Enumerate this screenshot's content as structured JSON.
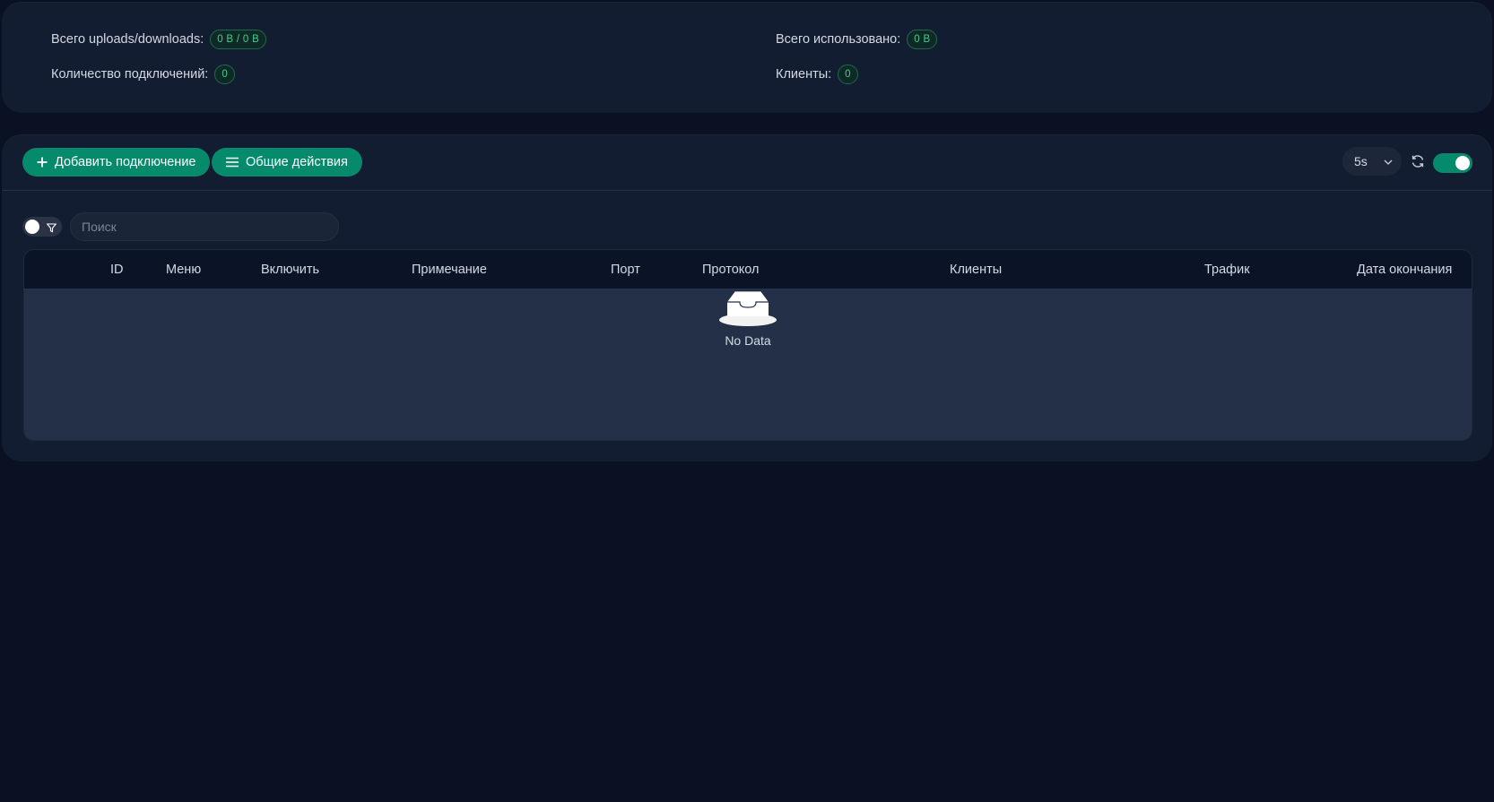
{
  "stats": {
    "total_updown_label": "Всего uploads/downloads:",
    "total_updown_value": "0 B / 0 B",
    "total_used_label": "Всего использовано:",
    "total_used_value": "0 B",
    "connections_label": "Количество подключений:",
    "connections_value": "0",
    "clients_label": "Клиенты:",
    "clients_value": "0"
  },
  "toolbar": {
    "add_label": "Добавить подключение",
    "actions_label": "Общие действия",
    "refresh_interval": "5s",
    "auto_refresh_on": true
  },
  "filter": {
    "search_placeholder": "Поиск",
    "filter_enabled": false
  },
  "table": {
    "columns": [
      "ID",
      "Меню",
      "Включить",
      "Примечание",
      "Порт",
      "Протокол",
      "Клиенты",
      "Трафик",
      "Дата окончания"
    ],
    "rows": [],
    "empty_text": "No Data"
  },
  "colors": {
    "accent": "#058b6c",
    "tag_text": "#3ecf8a",
    "background": "#0a1122",
    "card": "#131d31"
  },
  "icons": {
    "add": "plus-icon",
    "actions": "menu-icon",
    "interval": "chevron-down-icon",
    "refresh": "refresh-icon",
    "filter": "filter-icon",
    "empty": "empty-inbox-icon"
  }
}
